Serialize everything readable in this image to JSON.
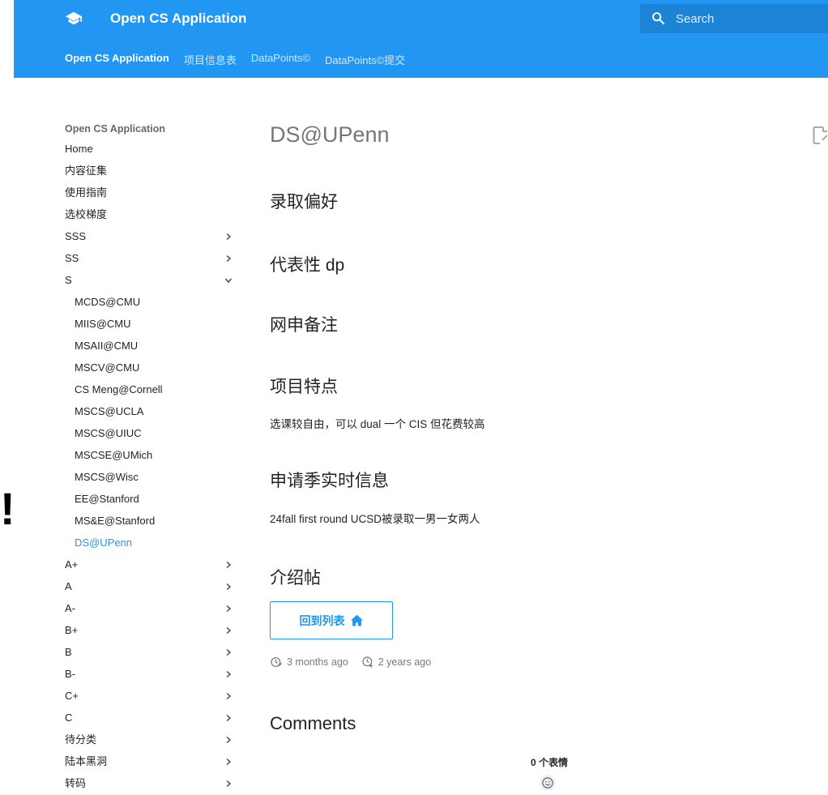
{
  "header": {
    "site_title": "Open CS Application",
    "search_placeholder": "Search",
    "tabs": [
      {
        "label": "Open CS Application",
        "active": true
      },
      {
        "label": "项目信息表",
        "active": false
      },
      {
        "label": "DataPoints©",
        "active": false
      },
      {
        "label": "DataPoints©提交",
        "active": false
      }
    ]
  },
  "sidebar": {
    "title": "Open CS Application",
    "items": [
      {
        "label": "Home",
        "chevron": "none",
        "level": 0
      },
      {
        "label": "内容征集",
        "chevron": "none",
        "level": 0
      },
      {
        "label": "使用指南",
        "chevron": "none",
        "level": 0
      },
      {
        "label": "选校梯度",
        "chevron": "none",
        "level": 0
      },
      {
        "label": "SSS",
        "chevron": "right",
        "level": 0
      },
      {
        "label": "SS",
        "chevron": "right",
        "level": 0
      },
      {
        "label": "S",
        "chevron": "down",
        "level": 0
      },
      {
        "label": "MCDS@CMU",
        "chevron": "none",
        "level": 1
      },
      {
        "label": "MIIS@CMU",
        "chevron": "none",
        "level": 1
      },
      {
        "label": "MSAII@CMU",
        "chevron": "none",
        "level": 1
      },
      {
        "label": "MSCV@CMU",
        "chevron": "none",
        "level": 1
      },
      {
        "label": "CS Meng@Cornell",
        "chevron": "none",
        "level": 1
      },
      {
        "label": "MSCS@UCLA",
        "chevron": "none",
        "level": 1
      },
      {
        "label": "MSCS@UIUC",
        "chevron": "none",
        "level": 1
      },
      {
        "label": "MSCSE@UMich",
        "chevron": "none",
        "level": 1
      },
      {
        "label": "MSCS@Wisc",
        "chevron": "none",
        "level": 1
      },
      {
        "label": "EE@Stanford",
        "chevron": "none",
        "level": 1
      },
      {
        "label": "MS&E@Stanford",
        "chevron": "none",
        "level": 1
      },
      {
        "label": "DS@UPenn",
        "chevron": "none",
        "level": 1,
        "active": true
      },
      {
        "label": "A+",
        "chevron": "right",
        "level": 0
      },
      {
        "label": "A",
        "chevron": "right",
        "level": 0
      },
      {
        "label": "A-",
        "chevron": "right",
        "level": 0
      },
      {
        "label": "B+",
        "chevron": "right",
        "level": 0
      },
      {
        "label": "B",
        "chevron": "right",
        "level": 0
      },
      {
        "label": "B-",
        "chevron": "right",
        "level": 0
      },
      {
        "label": "C+",
        "chevron": "right",
        "level": 0
      },
      {
        "label": "C",
        "chevron": "right",
        "level": 0
      },
      {
        "label": "待分类",
        "chevron": "right",
        "level": 0
      },
      {
        "label": "陆本黑洞",
        "chevron": "right",
        "level": 0
      },
      {
        "label": "转码",
        "chevron": "right",
        "level": 0
      }
    ]
  },
  "main": {
    "page_title": "DS@UPenn",
    "sections": {
      "preference": "录取偏好",
      "representative_dp": "代表性 dp",
      "notes": "网申备注",
      "features": "项目特点",
      "features_text": "选课较自由，可以 dual 一个 CIS 但花费较高",
      "realtime": "申请季实时信息",
      "realtime_text": "24fall first round UCSD被录取一男一女两人",
      "intro": "介绍帖"
    },
    "back_button": "回到列表",
    "updated": "3 months ago",
    "created": "2 years ago",
    "comments_title": "Comments",
    "reactions_label": "0 个表情"
  },
  "side_glyph": "!",
  "colors": {
    "primary": "#2196f3",
    "active_link": "#2196f3"
  },
  "icons": {
    "logo": "graduation-cap-icon",
    "search": "search-icon",
    "edit": "edit-icon",
    "home": "home-icon",
    "updated": "clock-edit-icon",
    "created": "clock-plus-icon",
    "reaction": "smiley-icon"
  }
}
